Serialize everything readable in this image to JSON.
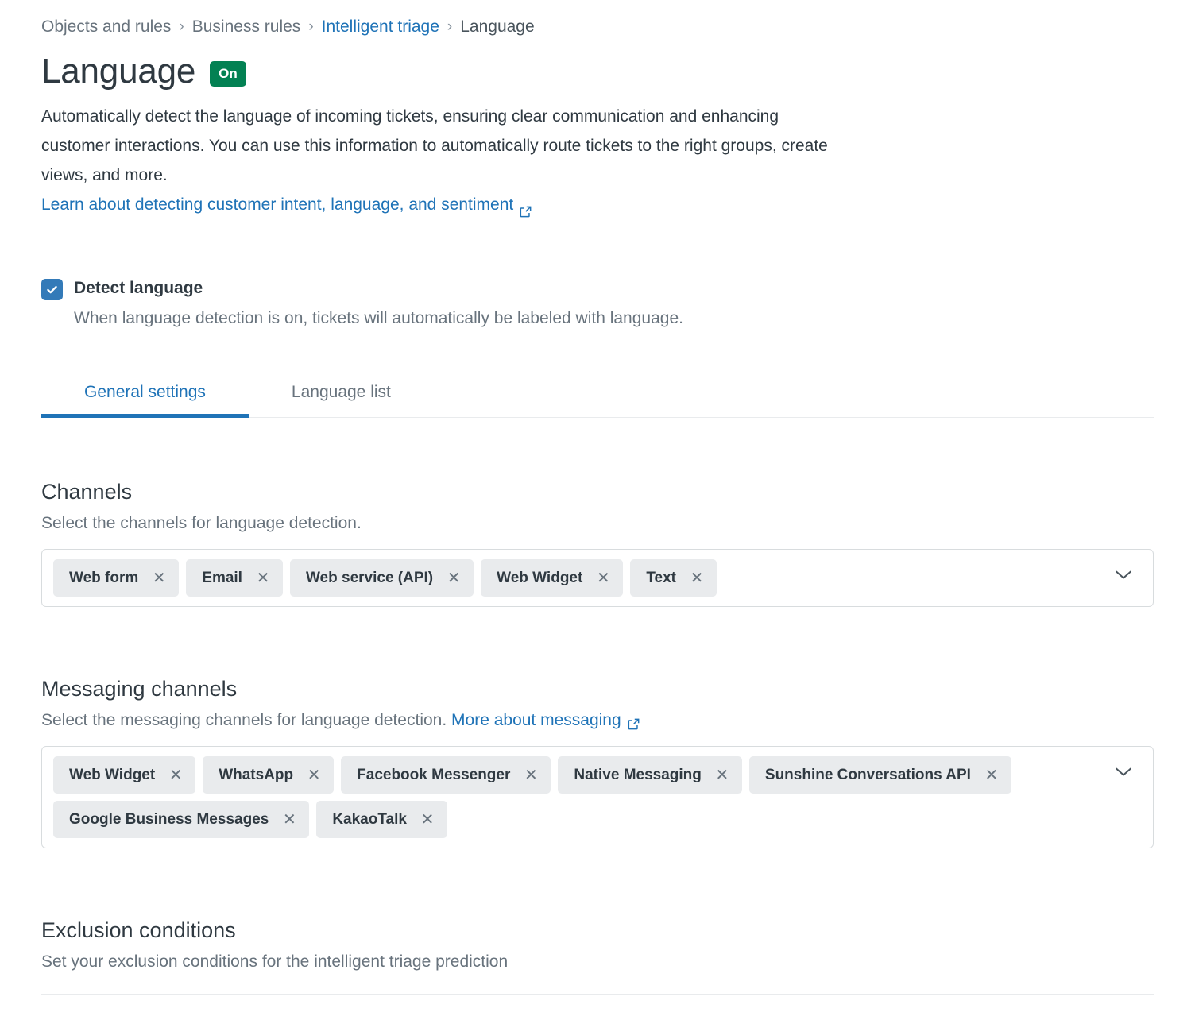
{
  "breadcrumb": {
    "separator": "›",
    "items": [
      {
        "label": "Objects and rules",
        "type": "muted"
      },
      {
        "label": "Business rules",
        "type": "muted"
      },
      {
        "label": "Intelligent triage",
        "type": "link"
      },
      {
        "label": "Language",
        "type": "current"
      }
    ]
  },
  "header": {
    "title": "Language",
    "status_badge": "On",
    "badge_color": "#038153",
    "description": "Automatically detect the language of incoming tickets, ensuring clear communication and enhancing customer interactions. You can use this information to automatically route tickets to the right groups, create views, and more.",
    "learn_link": "Learn about detecting customer intent, language, and sentiment"
  },
  "detect": {
    "label": "Detect language",
    "checked": true,
    "hint": "When language detection is on, tickets will automatically be labeled with language.",
    "checkbox_color": "#337ab8"
  },
  "tabs": [
    {
      "label": "General settings",
      "active": true
    },
    {
      "label": "Language list",
      "active": false
    }
  ],
  "channels": {
    "title": "Channels",
    "subtitle": "Select the channels for language detection.",
    "selected": [
      "Web form",
      "Email",
      "Web service (API)",
      "Web Widget",
      "Text"
    ],
    "remove_glyph": "✕"
  },
  "messaging_channels": {
    "title": "Messaging channels",
    "subtitle": "Select the messaging channels for language detection.",
    "link": "More about messaging",
    "selected": [
      "Web Widget",
      "WhatsApp",
      "Facebook Messenger",
      "Native Messaging",
      "Sunshine Conversations API",
      "Google Business Messages",
      "KakaoTalk"
    ],
    "remove_glyph": "✕"
  },
  "exclusion": {
    "title": "Exclusion conditions",
    "subtitle": "Set your exclusion conditions for the intelligent triage prediction"
  },
  "accent_color": "#1f73b7"
}
